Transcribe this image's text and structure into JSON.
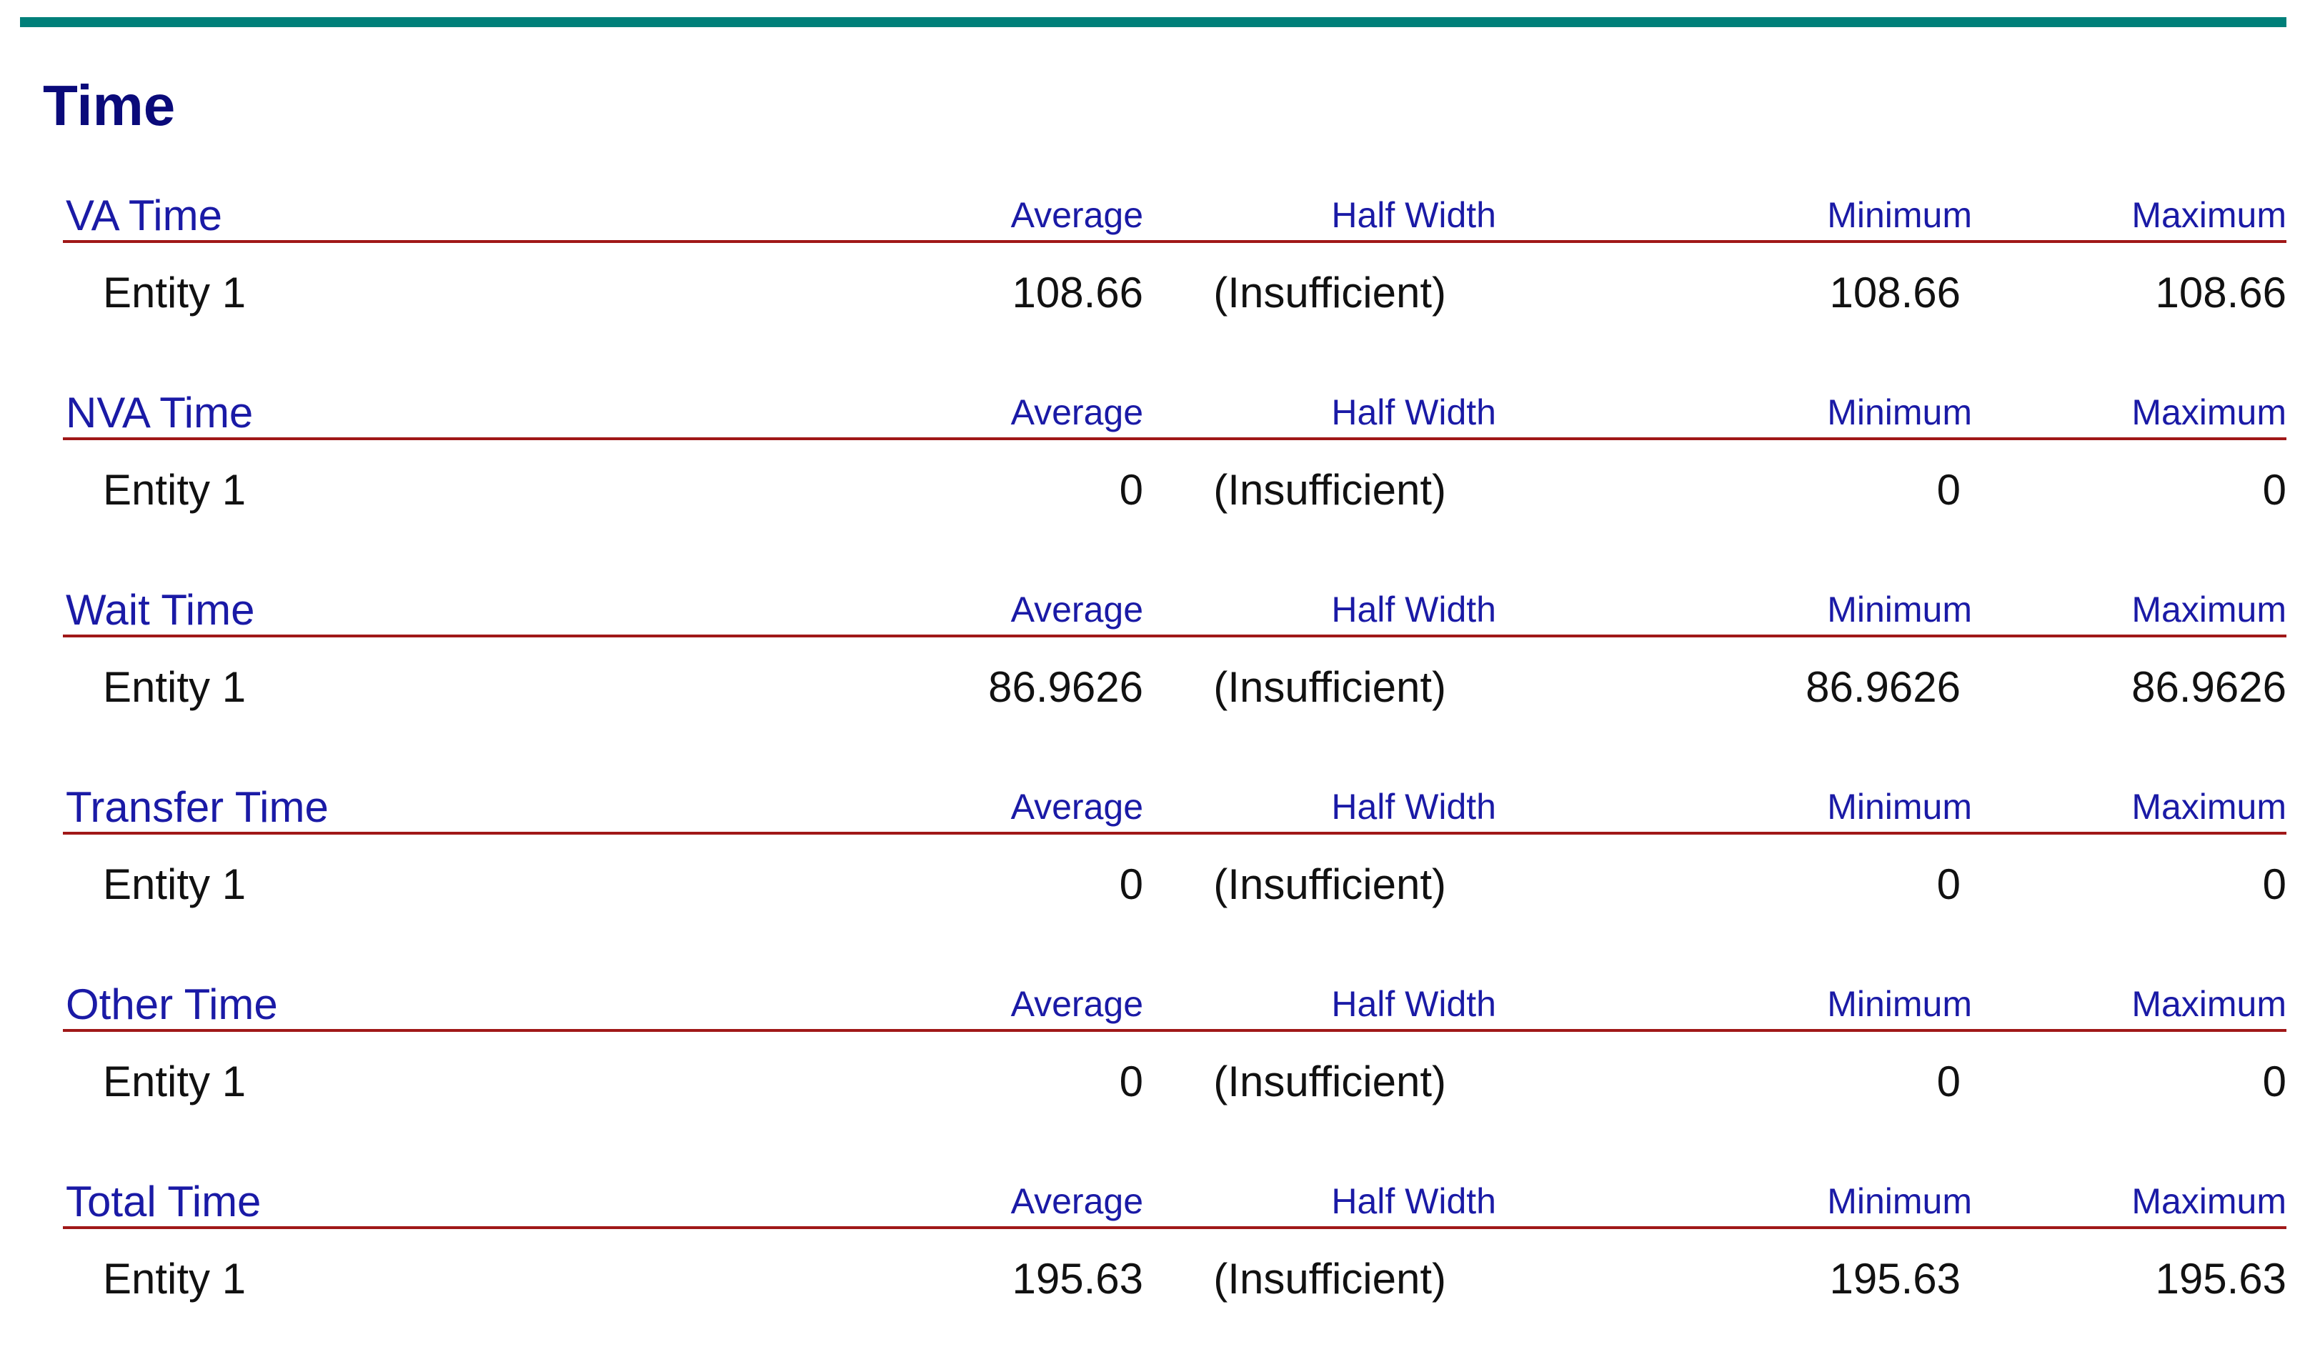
{
  "report": {
    "title": "Time"
  },
  "columns": {
    "average": "Average",
    "half_width": "Half Width",
    "minimum": "Minimum",
    "maximum": "Maximum"
  },
  "sections": [
    {
      "name": "VA Time",
      "rows": [
        {
          "entity": "Entity 1",
          "average": "108.66",
          "half_width": "(Insufficient)",
          "minimum": "108.66",
          "maximum": "108.66"
        }
      ]
    },
    {
      "name": "NVA Time",
      "rows": [
        {
          "entity": "Entity 1",
          "average": "0",
          "half_width": "(Insufficient)",
          "minimum": "0",
          "maximum": "0"
        }
      ]
    },
    {
      "name": "Wait Time",
      "rows": [
        {
          "entity": "Entity 1",
          "average": "86.9626",
          "half_width": "(Insufficient)",
          "minimum": "86.9626",
          "maximum": "86.9626"
        }
      ]
    },
    {
      "name": "Transfer Time",
      "rows": [
        {
          "entity": "Entity 1",
          "average": "0",
          "half_width": "(Insufficient)",
          "minimum": "0",
          "maximum": "0"
        }
      ]
    },
    {
      "name": "Other Time",
      "rows": [
        {
          "entity": "Entity 1",
          "average": "0",
          "half_width": "(Insufficient)",
          "minimum": "0",
          "maximum": "0"
        }
      ]
    },
    {
      "name": "Total Time",
      "rows": [
        {
          "entity": "Entity 1",
          "average": "195.63",
          "half_width": "(Insufficient)",
          "minimum": "195.63",
          "maximum": "195.63"
        }
      ]
    }
  ]
}
